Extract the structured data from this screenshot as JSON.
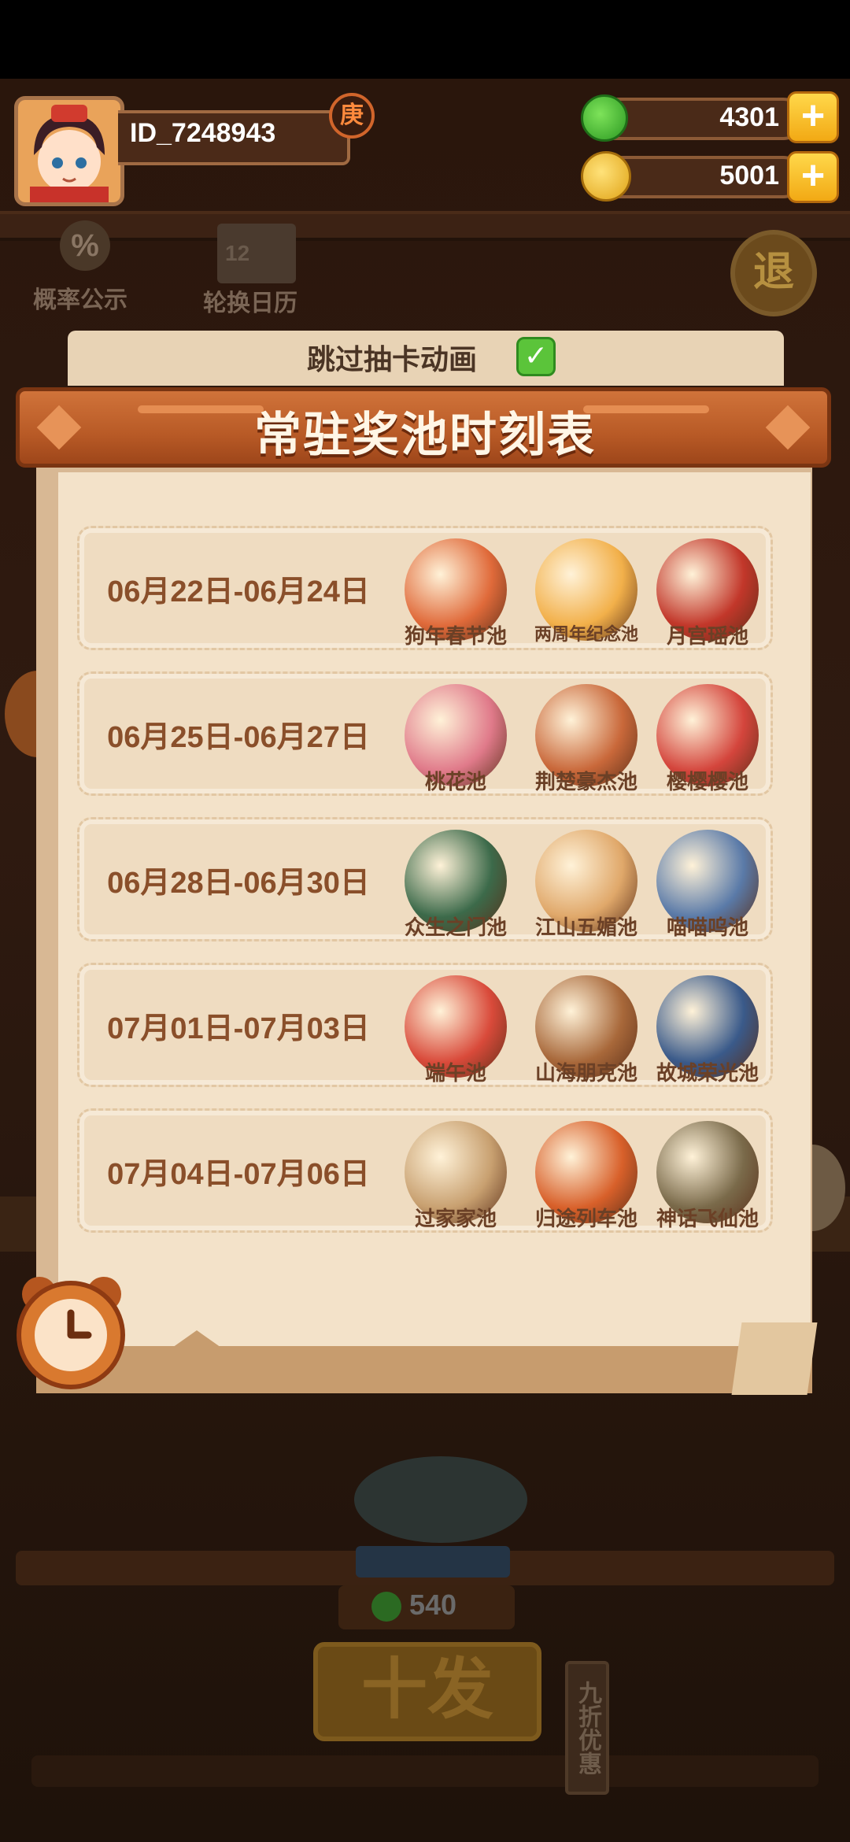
{
  "top_bar": {
    "player_id": "ID_7248943",
    "rank_badge": "庚",
    "jade_amount": "4301",
    "coin_amount": "5001",
    "plus_label": "+"
  },
  "side_buttons": {
    "probability_icon_text": "%",
    "probability_label": "概率公示",
    "calendar_icon_text": "12",
    "calendar_label": "轮换日历",
    "exit_label": "退"
  },
  "skip_animation": {
    "label": "跳过抽卡动画",
    "checked": true,
    "check_mark": "✓"
  },
  "schedule": {
    "title": "常驻奖池时刻表",
    "rows": [
      {
        "date": "06月22日-06月24日",
        "pools": [
          "狗年春节池",
          "两周年纪念池",
          "月宫瑶池"
        ]
      },
      {
        "date": "06月25日-06月27日",
        "pools": [
          "桃花池",
          "荆楚豪杰池",
          "樱樱樱池"
        ]
      },
      {
        "date": "06月28日-06月30日",
        "pools": [
          "众生之门池",
          "江山五媚池",
          "喵喵呜池"
        ]
      },
      {
        "date": "07月01日-07月03日",
        "pools": [
          "端午池",
          "山海朋克池",
          "故城荣光池"
        ]
      },
      {
        "date": "07月04日-07月06日",
        "pools": [
          "过家家池",
          "归途列车池",
          "神话飞仙池"
        ]
      }
    ]
  },
  "bottom": {
    "cost": "540",
    "ten_draw_label": "十发",
    "discount_label": "九折优惠"
  },
  "colors": {
    "panel": "#f3e2c9",
    "banner": "#b85a26",
    "date_text": "#8a4f2a"
  }
}
